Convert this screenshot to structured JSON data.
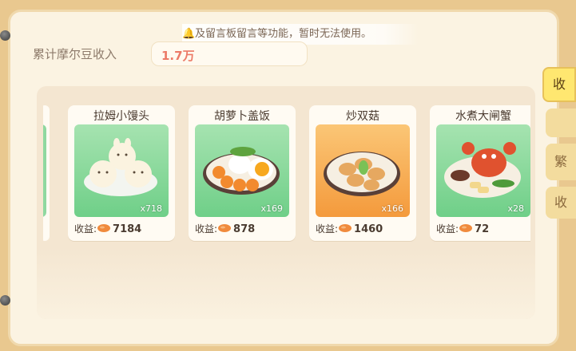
{
  "notice": {
    "text": "及留言板留言等功能，暂时无法使用。",
    "icon": "bell-icon"
  },
  "income": {
    "label": "累计摩尔豆收入",
    "value": "1.7万"
  },
  "profit_label": "收益:",
  "dishes": [
    {
      "name": "拉姆小馒头",
      "count": "x718",
      "profit": "7184",
      "bg": "green"
    },
    {
      "name": "胡萝卜盖饭",
      "count": "x169",
      "profit": "878",
      "bg": "green"
    },
    {
      "name": "炒双菇",
      "count": "x166",
      "profit": "1460",
      "bg": "orange"
    },
    {
      "name": "水煮大闸蟹",
      "count": "x28",
      "profit": "72",
      "bg": "green"
    }
  ],
  "tabs": [
    "收",
    "繁",
    "收"
  ],
  "colors": {
    "accent": "#ec7a67",
    "active_tab": "#ffe770",
    "green_bg": "#8fd8a0",
    "orange_bg": "#f7a850"
  }
}
